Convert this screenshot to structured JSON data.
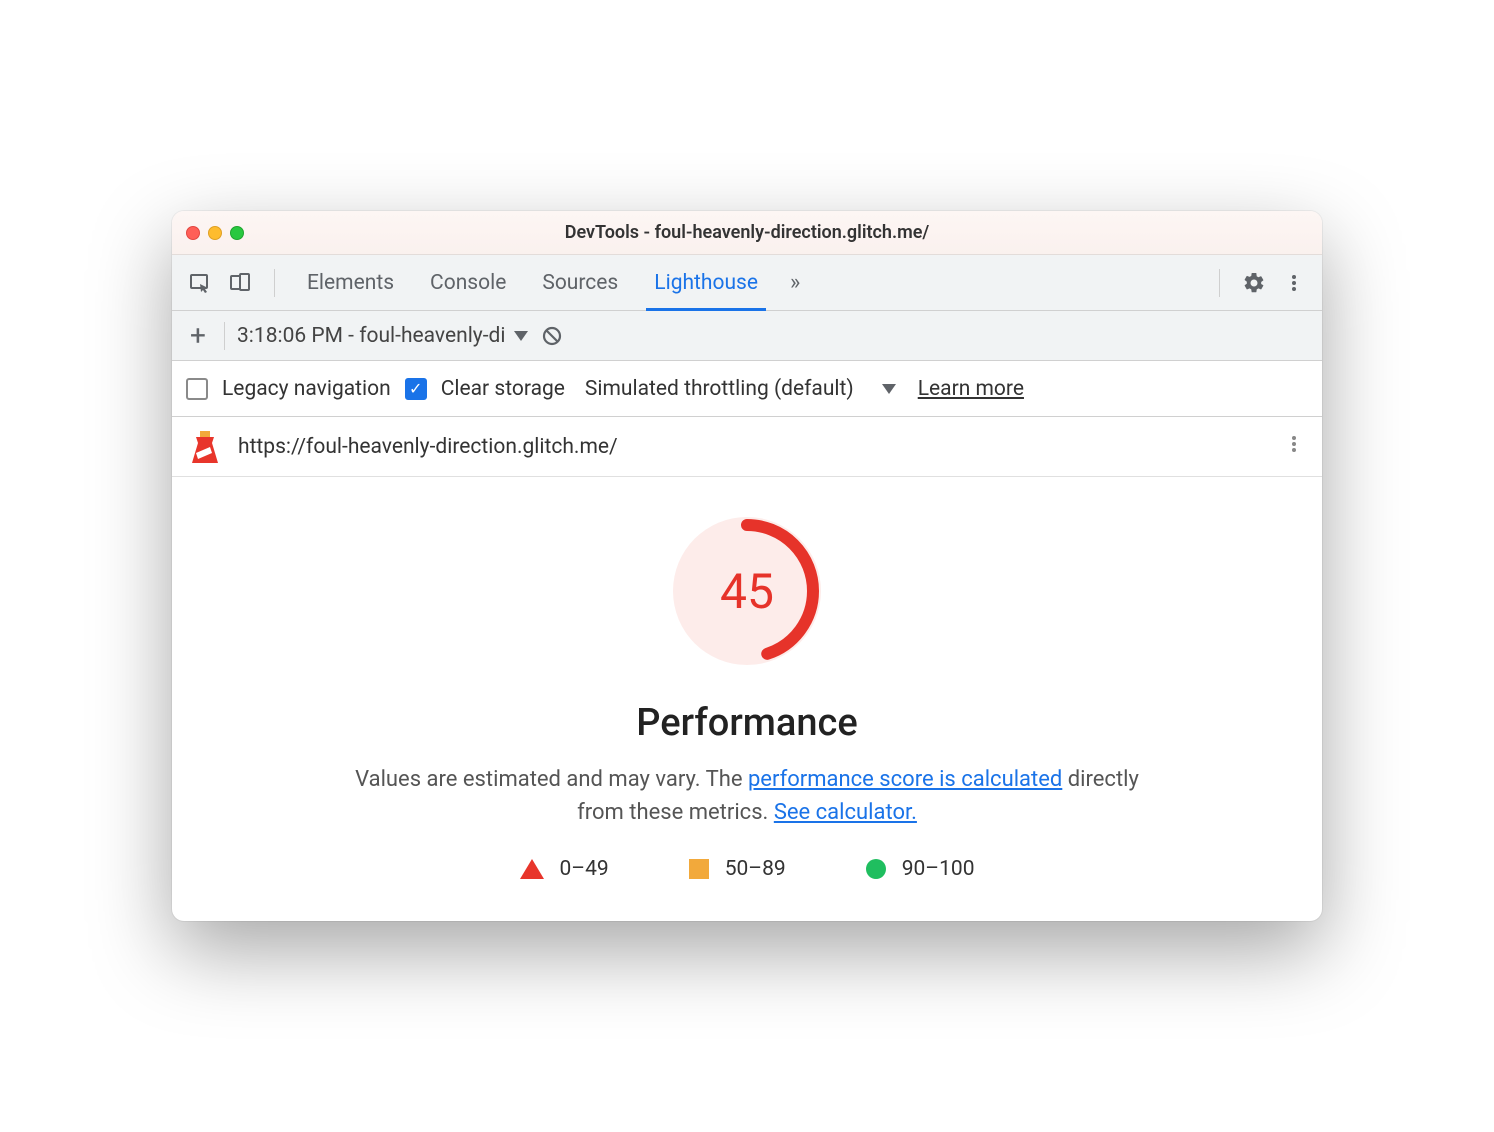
{
  "window": {
    "title": "DevTools - foul-heavenly-direction.glitch.me/"
  },
  "tabs": {
    "items": [
      "Elements",
      "Console",
      "Sources",
      "Lighthouse"
    ],
    "active_index": 3
  },
  "subbar": {
    "report_label": "3:18:06 PM - foul-heavenly-di"
  },
  "options": {
    "legacy_label": "Legacy navigation",
    "legacy_checked": false,
    "clear_label": "Clear storage",
    "clear_checked": true,
    "throttling_label": "Simulated throttling (default)",
    "learn_more": "Learn more"
  },
  "url_row": {
    "url": "https://foul-heavenly-direction.glitch.me/"
  },
  "report": {
    "score": "45",
    "heading": "Performance",
    "desc_pre": "Values are estimated and may vary. The ",
    "link1": "performance score is calculated",
    "desc_mid": " directly from these metrics. ",
    "link2": "See calculator.",
    "legend": {
      "low": "0–49",
      "mid": "50–89",
      "high": "90–100"
    }
  }
}
